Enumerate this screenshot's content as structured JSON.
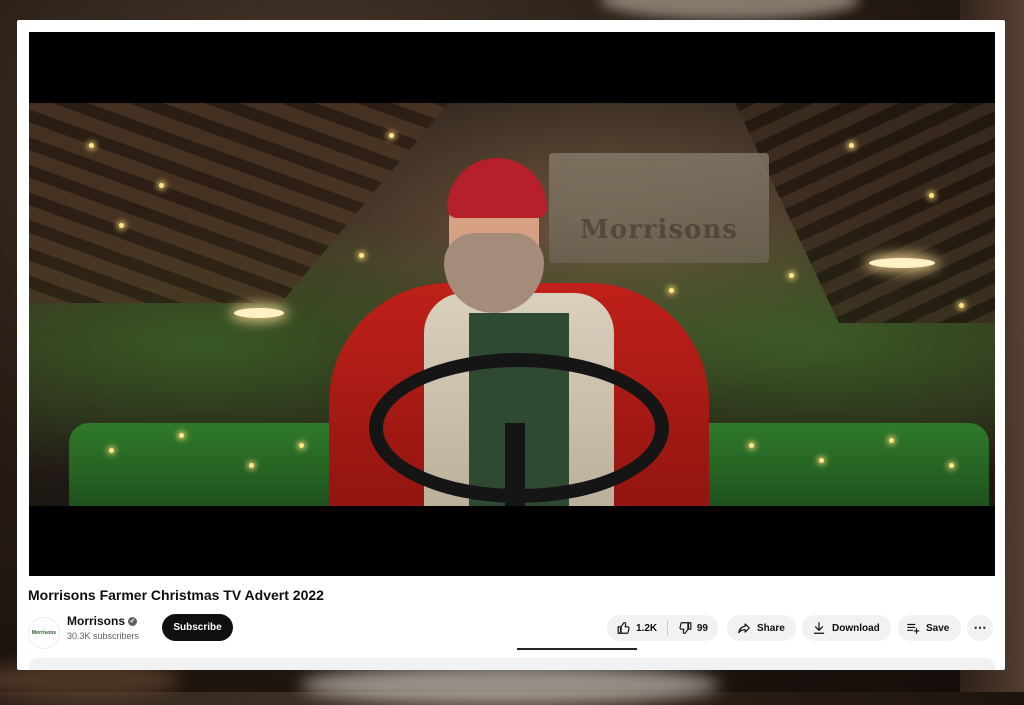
{
  "video": {
    "title": "Morrisons Farmer Christmas TV Advert 2022",
    "frame_sign_text": "Morrisons"
  },
  "channel": {
    "logo_text": "Morrisons",
    "name": "Morrisons",
    "subscribers": "30.3K subscribers",
    "subscribe_label": "Subscribe"
  },
  "actions": {
    "likes": "1.2K",
    "dislikes": "99",
    "share_label": "Share",
    "download_label": "Download",
    "save_label": "Save",
    "more_label": "⋯"
  },
  "icons": {
    "like": "thumbs-up-icon",
    "dislike": "thumbs-down-icon",
    "share": "share-arrow-icon",
    "download": "download-icon",
    "save": "playlist-add-icon",
    "verified": "verified-check-icon"
  },
  "colors": {
    "subscribe_bg": "#0f0f0f",
    "pill_bg": "#f2f2f2",
    "text_primary": "#0f0f0f",
    "text_secondary": "#606060"
  }
}
